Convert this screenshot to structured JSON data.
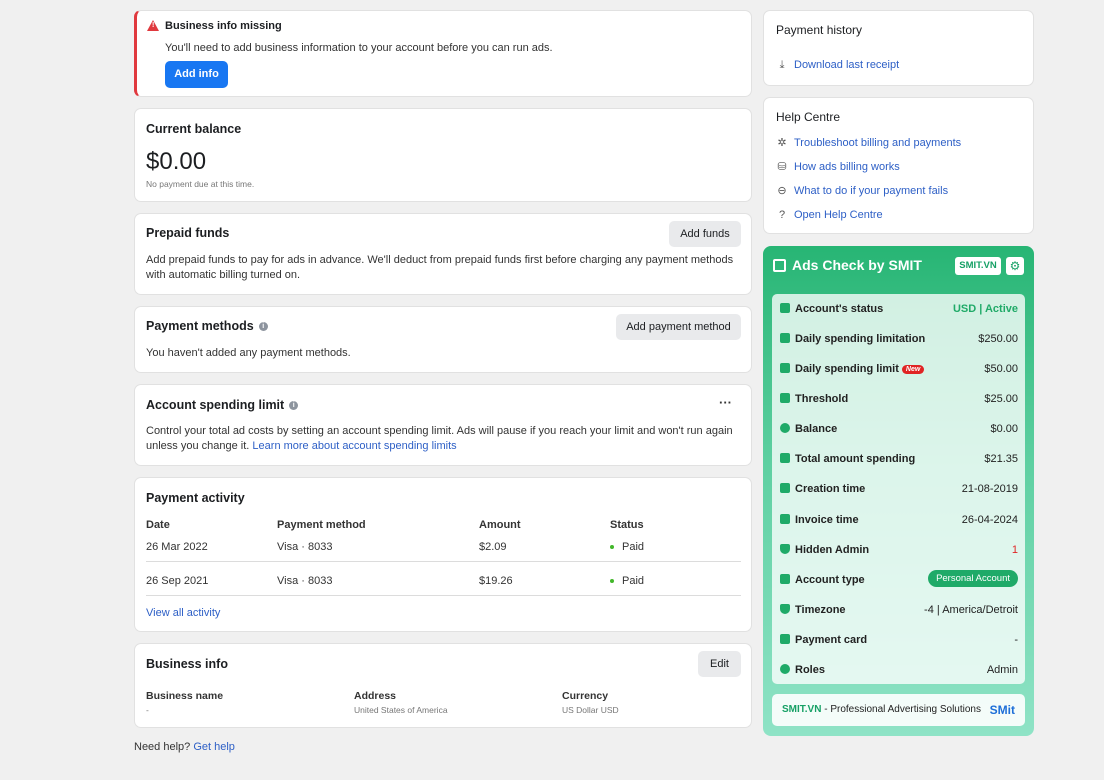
{
  "alert": {
    "title": "Business info missing",
    "message": "You'll need to add business information to your account before you can run ads.",
    "button": "Add info"
  },
  "balance": {
    "title": "Current balance",
    "amount": "$0.00",
    "note": "No payment due at this time."
  },
  "prepaid": {
    "title": "Prepaid funds",
    "button": "Add funds",
    "text": "Add prepaid funds to pay for ads in advance. We'll deduct from prepaid funds first before charging any payment methods with automatic billing turned on."
  },
  "payment_methods": {
    "title": "Payment methods",
    "button": "Add payment method",
    "text": "You haven't added any payment methods."
  },
  "spending_limit": {
    "title": "Account spending limit",
    "more": "···",
    "text": "Control your total ad costs by setting an account spending limit. Ads will pause if you reach your limit and won't run again unless you change it.",
    "link": "Learn more about account spending limits"
  },
  "activity": {
    "title": "Payment activity",
    "columns": [
      "Date",
      "Payment method",
      "Amount",
      "Status"
    ],
    "rows": [
      {
        "date": "26 Mar 2022",
        "method": "Visa · 8033",
        "amount": "$2.09",
        "status": "Paid"
      },
      {
        "date": "26 Sep 2021",
        "method": "Visa · 8033",
        "amount": "$19.26",
        "status": "Paid"
      }
    ],
    "view_all": "View all activity"
  },
  "business": {
    "title": "Business info",
    "button": "Edit",
    "fields": [
      {
        "label": "Business name",
        "value": "-"
      },
      {
        "label": "Address",
        "value": "United States of America"
      },
      {
        "label": "Currency",
        "value": "US Dollar USD"
      }
    ]
  },
  "footer": {
    "need_help": "Need help?",
    "get_help": "Get help"
  },
  "payment_history": {
    "title": "Payment history",
    "download": "Download last receipt"
  },
  "help_centre": {
    "title": "Help Centre",
    "links": [
      {
        "icon": "wrench-icon",
        "label": "Troubleshoot billing and payments"
      },
      {
        "icon": "coins-icon",
        "label": "How ads billing works"
      },
      {
        "icon": "minus-circle-icon",
        "label": "What to do if your payment fails"
      },
      {
        "icon": "question-icon",
        "label": "Open Help Centre"
      }
    ]
  },
  "smit": {
    "title": "Ads Check by SMIT",
    "tag": "SMIT.VN",
    "rows": [
      {
        "label": "Account's status",
        "value": "USD | Active",
        "color": "#1faa68"
      },
      {
        "label": "Daily spending limitation",
        "value": "$250.00"
      },
      {
        "label": "Daily spending limit",
        "value": "$50.00",
        "badge": "New"
      },
      {
        "label": "Threshold",
        "value": "$25.00"
      },
      {
        "label": "Balance",
        "value": "$0.00"
      },
      {
        "label": "Total amount spending",
        "value": "$21.35"
      },
      {
        "label": "Creation time",
        "value": "21-08-2019"
      },
      {
        "label": "Invoice time",
        "value": "26-04-2024"
      },
      {
        "label": "Hidden Admin",
        "value": "1",
        "color": "#e02424"
      },
      {
        "label": "Account type",
        "value": "Personal Account",
        "pill": true
      },
      {
        "label": "Timezone",
        "value": "-4 | America/Detroit"
      },
      {
        "label": "Payment card",
        "value": "-"
      },
      {
        "label": "Roles",
        "value": "Admin"
      }
    ],
    "footer_brand": "SMIT.VN",
    "footer_text": " - Professional Advertising Solutions",
    "footer_logo": "SMit"
  }
}
